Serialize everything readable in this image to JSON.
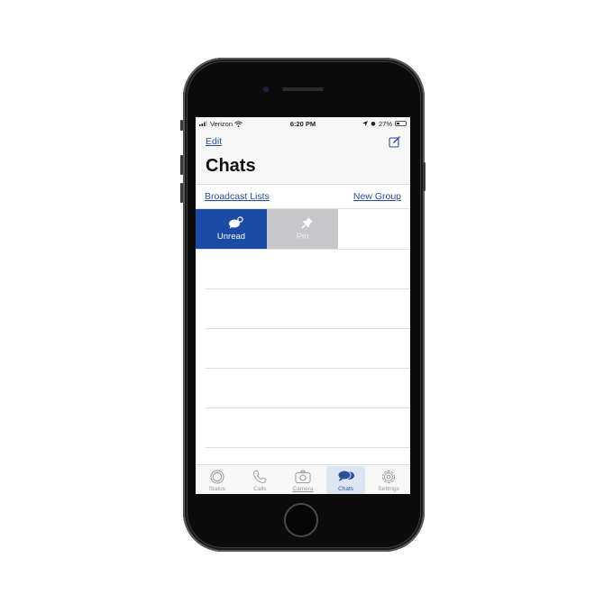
{
  "status_bar": {
    "carrier": "Verizon",
    "time": "6:20 PM",
    "battery": "27%"
  },
  "header": {
    "edit_label": "Edit",
    "title": "Chats",
    "compose_icon": "compose-icon"
  },
  "links": {
    "broadcast_label": "Broadcast Lists",
    "new_group_label": "New Group"
  },
  "swipe_actions": [
    {
      "label": "Unread",
      "icon": "unread-chat-icon",
      "color": "#1b4ba5"
    },
    {
      "label": "Pin",
      "icon": "pin-icon",
      "color": "#c6c6cb"
    }
  ],
  "chat_rows": 5,
  "tabs": [
    {
      "label": "Status",
      "icon": "status-icon",
      "active": false
    },
    {
      "label": "Calls",
      "icon": "phone-icon",
      "active": false
    },
    {
      "label": "Camera",
      "icon": "camera-icon",
      "active": false
    },
    {
      "label": "Chats",
      "icon": "chats-icon",
      "active": true
    },
    {
      "label": "Settings",
      "icon": "gear-icon",
      "active": false
    }
  ],
  "colors": {
    "accent": "#2b4f9a",
    "unread_action": "#1b4ba5",
    "pin_action": "#c6c6cb"
  }
}
